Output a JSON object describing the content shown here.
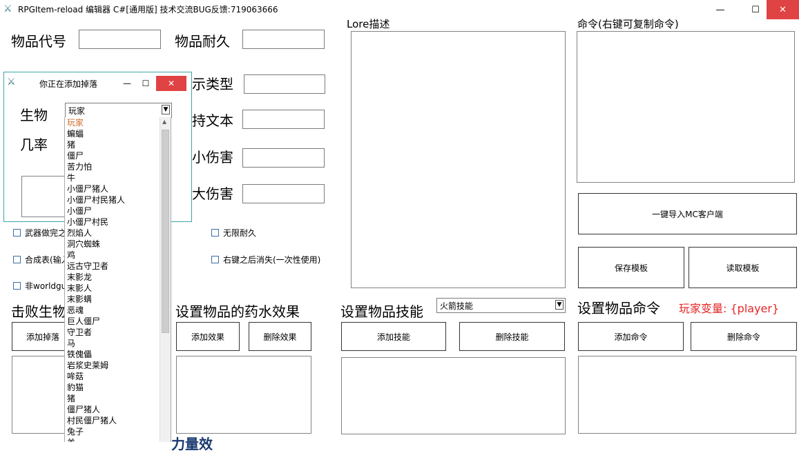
{
  "window": {
    "title": "RPGItem-reload 编辑器 C#[通用版] 技术交流BUG反馈:719063666",
    "minimize": "—",
    "maximize": "☐",
    "close": "✕"
  },
  "fields": {
    "item_code_label": "物品代号",
    "item_durability_label": "物品耐久",
    "display_type_label_partial": "示类型",
    "hold_text_label_partial": "持文本",
    "min_damage_label_partial": "小伤害",
    "max_damage_label_partial": "大伤害"
  },
  "checkboxes": {
    "weapon_partial": "武器做完之",
    "infinite_durability": "无限耐久",
    "crafting_partial": "合成表(输入",
    "disappear_after_use": "右键之后消失(一次性使用)",
    "worldguard_partial": "非worldgu"
  },
  "lore": {
    "label": "Lore描述"
  },
  "commands": {
    "label": "命令(右键可复制命令)",
    "import_button": "一键导入MC客户端",
    "save_template": "保存模板",
    "load_template": "读取模板"
  },
  "sections": {
    "kill_mob_partial": "击败生物",
    "add_drop": "添加掉落",
    "potion_title": "设置物品的药水效果",
    "add_effect": "添加效果",
    "delete_effect": "删除效果",
    "skill_title": "设置物品技能",
    "skill_selected": "火箭技能",
    "add_skill": "添加技能",
    "delete_skill": "删除技能",
    "command_title": "设置物品命令",
    "player_var": "玩家变量: {player}",
    "add_command": "添加命令",
    "delete_command": "删除命令",
    "bottom_partial": "力量效"
  },
  "dialog": {
    "title": "你正在添加掉落",
    "mob_label": "生物",
    "chance_label": "几率",
    "mob_selected": "玩家",
    "mob_options": [
      "玩家",
      "蝙蝠",
      "猪",
      "僵尸",
      "苦力怕",
      "牛",
      "小僵尸猪人",
      "小僵尸村民猪人",
      "小僵尸",
      "小僵尸村民",
      "烈焰人",
      "洞穴蜘蛛",
      "鸡",
      "远古守卫者",
      "末影龙",
      "末影人",
      "末影螨",
      "恶魂",
      "巨人僵尸",
      "守卫者",
      "马",
      "铁傀儡",
      "岩浆史莱姆",
      "哞菇",
      "豹猫",
      "猪",
      "僵尸猪人",
      "村民僵尸猪人",
      "兔子",
      "羊"
    ]
  },
  "colors": {
    "accent_red": "#e52525",
    "dialog_border": "#39a6a6",
    "close_red": "#e04343"
  }
}
